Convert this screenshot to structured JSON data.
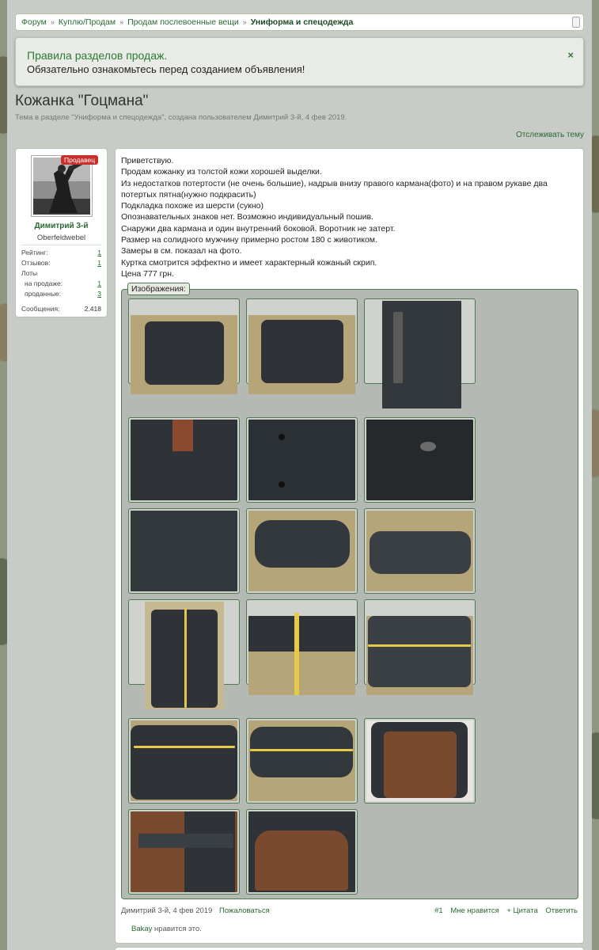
{
  "breadcrumb": {
    "items": [
      "Форум",
      "Куплю/Продам",
      "Продам послевоенные вещи"
    ],
    "current": "Униформа и спецодежда"
  },
  "notice": {
    "line1": "Правила разделов продаж.",
    "line2": "Обязательно ознакомьтесь перед созданием объявления!",
    "close_glyph": "×"
  },
  "thread": {
    "title": "Кожанка \"Гоцмана\"",
    "subtitle": "Тема в разделе \"Униформа и спецодежда\", создана пользователем Димитрий 3-й, 4 фев 2019.",
    "watch": "Отслеживать тему"
  },
  "user": {
    "badge": "Продавец",
    "name": "Димитрий 3-й",
    "rank": "Oberfeldwebel",
    "stats": {
      "rating_label": "Рейтинг:",
      "rating_value": "1",
      "reviews_label": "Отзывов:",
      "reviews_value": "1",
      "lots_label": "Лоты",
      "on_sale_label": "на продаже:",
      "on_sale_value": "1",
      "sold_label": "проданные:",
      "sold_value": "3",
      "messages_label": "Сообщения:",
      "messages_value": "2.418"
    }
  },
  "post": {
    "lines": [
      "Приветствую.",
      "Продам кожанку из толстой кожи хорошей выделки.",
      "Из недостатков потертости (не очень большие), надрыв внизу правого кармана(фото) и на правом рукаве два",
      "потертых пятна(нужно подкрасить)",
      "Подкладка похоже из шерсти (сукно)",
      "Опознавательных знаков нет. Возможно индивидуальный пошив.",
      "Снаружи два кармана и один внутренний боковой. Воротник не затерт.",
      "Размер на солидного мужчину примерно ростом 180 с животиком.",
      "Замеры в см. показал на фото.",
      "Куртка смотрится эффектно и имеет характерный кожаный скрип.",
      "Цена 777 грн."
    ],
    "images_label": "Изображения:",
    "footer": {
      "author_date": "Димитрий 3-й, 4 фев 2019",
      "report": "Пожаловаться",
      "number": "#1",
      "like": "Мне нравится",
      "quote": "+ Цитата",
      "reply": "Ответить"
    },
    "likes": {
      "user": "Bakay",
      "text": " нравится это."
    }
  },
  "colors": {
    "accent": "#2a6a32",
    "badge": "#c7302c",
    "leather": "#2e3338",
    "lining": "#7a4a2e"
  }
}
